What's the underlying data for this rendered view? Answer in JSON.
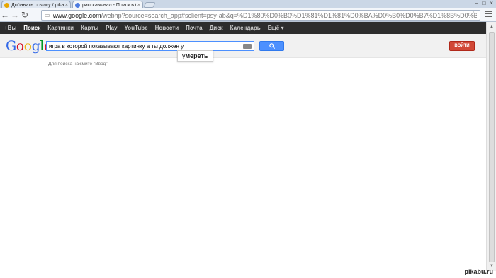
{
  "tabs": [
    {
      "title": "Добавить ссылку / pikabu",
      "favicon_color": "#e8a700",
      "active": false
    },
    {
      "title": "рассказывал - Поиск в Google",
      "favicon_color": "#4d7be0",
      "active": true
    }
  ],
  "toolbar": {
    "url_host": "www.google.com",
    "url_path": "/webhp?source=search_app#sclient=psy-ab&q=%D1%80%D0%B0%D1%81%D1%81%D0%BA%D0%B0%D0%B7%D1%8B%D0%B2%D0%B0%D0%BB+&oq=%"
  },
  "gbar": {
    "items": [
      "+Вы",
      "Поиск",
      "Картинки",
      "Карты",
      "Play",
      "YouTube",
      "Новости",
      "Почта",
      "Диск",
      "Календарь",
      "Ещё ▾"
    ],
    "selected": "Поиск"
  },
  "header": {
    "logo_letters": [
      {
        "ch": "G",
        "color": "#3369e8"
      },
      {
        "ch": "o",
        "color": "#d50f25"
      },
      {
        "ch": "o",
        "color": "#eeb211"
      },
      {
        "ch": "g",
        "color": "#3369e8"
      },
      {
        "ch": "l",
        "color": "#009925"
      },
      {
        "ch": "e",
        "color": "#d50f25"
      }
    ],
    "query": "игра в которой показывают картинку а ты должен у",
    "signin_label": "ВОЙТИ"
  },
  "suggestion": {
    "prefix": "у",
    "completion": "мереть"
  },
  "hint": "Для поиска нажмите \"Ввод\"",
  "watermark": "pikabu.ru"
}
